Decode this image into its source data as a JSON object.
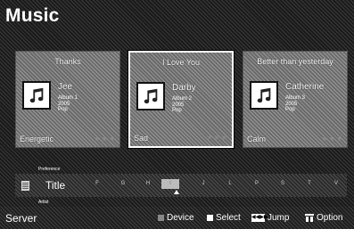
{
  "app": {
    "title": "Music"
  },
  "cards": [
    {
      "title": "Thanks",
      "artist": "Jee",
      "album": "Album 1",
      "year": "2005",
      "genre": "Pop",
      "mood": "Energetic",
      "stars": "★★★",
      "selected": false
    },
    {
      "title": "I Love You",
      "artist": "Darby",
      "album": "Album 2",
      "year": "2005",
      "genre": "Pop",
      "mood": "Sad",
      "stars": "★★★",
      "selected": true
    },
    {
      "title": "Better than yesterday",
      "artist": "Catherine",
      "album": "Album 3",
      "year": "2005",
      "genre": "Pop",
      "mood": "Calm",
      "stars": "★★★",
      "selected": false
    }
  ],
  "sort": {
    "above_label": "Preference",
    "current": "Title",
    "below_label": "Artist",
    "letters": [
      "F",
      "G",
      "H",
      "I",
      "J",
      "L",
      "P",
      "S",
      "T",
      "V"
    ],
    "active_letter_index": 3
  },
  "bottom": {
    "server": "Server",
    "hints": {
      "device": "Device",
      "select": "Select",
      "jump": "Jump",
      "option": "Option"
    }
  }
}
